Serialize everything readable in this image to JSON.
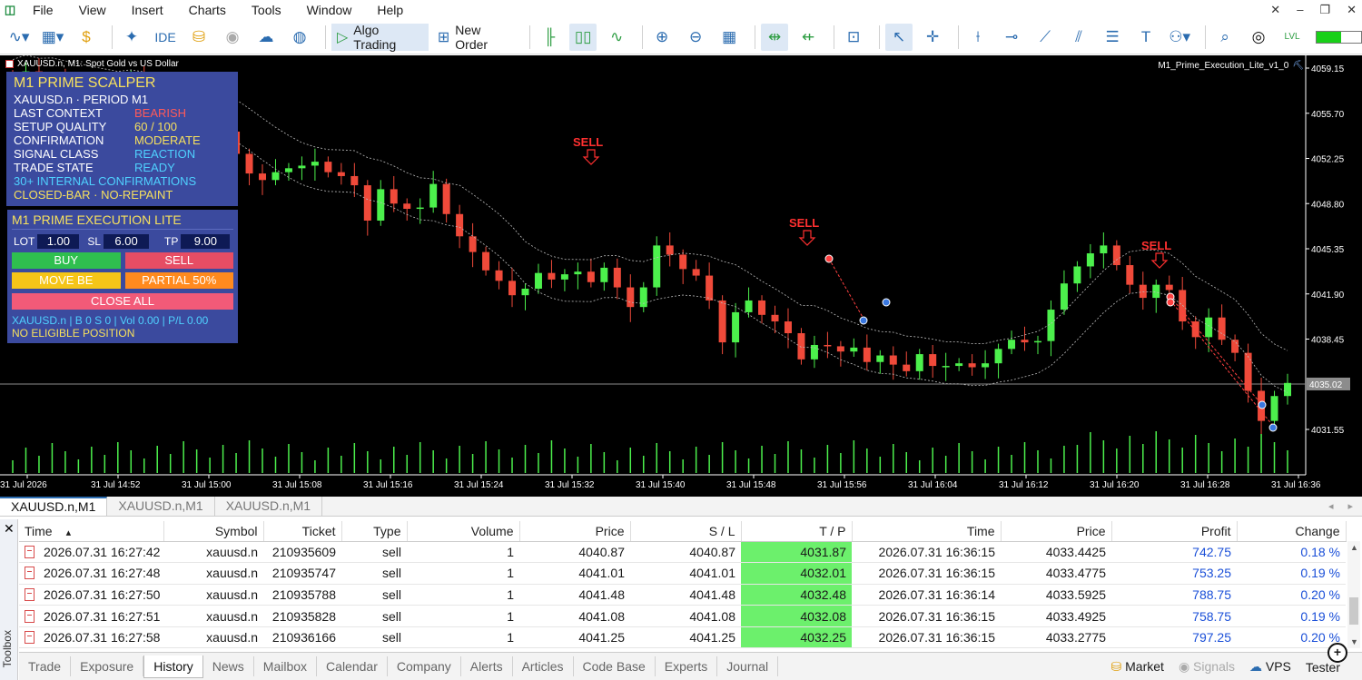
{
  "menu": {
    "items": [
      "File",
      "View",
      "Insert",
      "Charts",
      "Tools",
      "Window",
      "Help"
    ]
  },
  "toolbar": {
    "algo_trading": "Algo Trading",
    "new_order": "New Order",
    "ide_label": "IDE",
    "level_fill_fraction": 0.55
  },
  "chart": {
    "title": "XAUUSD.n, M1:  Spot Gold vs US Dollar",
    "ea_name": "M1_Prime_Execution_Lite_v1_0",
    "current_price": "4035.02",
    "price_labels": [
      "4059.15",
      "4055.70",
      "4052.25",
      "4048.80",
      "4045.35",
      "4041.90",
      "4038.45",
      "4031.55"
    ],
    "time_labels": [
      "31 Jul 2026",
      "31 Jul 14:52",
      "31 Jul 15:00",
      "31 Jul 15:08",
      "31 Jul 15:16",
      "31 Jul 15:24",
      "31 Jul 15:32",
      "31 Jul 15:40",
      "31 Jul 15:48",
      "31 Jul 15:56",
      "31 Jul 16:04",
      "31 Jul 16:12",
      "31 Jul 16:20",
      "31 Jul 16:28",
      "31 Jul 16:36"
    ],
    "signal_label": "SELL",
    "bull_color": "#4cf04c",
    "bear_color": "#f04a3a"
  },
  "scalper": {
    "title": "M1 PRIME SCALPER",
    "symbol_period": "XAUUSD.n · PERIOD M1",
    "rows": [
      {
        "label": "LAST CONTEXT",
        "value": "BEARISH",
        "color": "#ff5a5a"
      },
      {
        "label": "SETUP QUALITY",
        "value": "60 / 100",
        "color": "#f6e05e"
      },
      {
        "label": "CONFIRMATION",
        "value": "MODERATE",
        "color": "#f6e05e"
      },
      {
        "label": "SIGNAL CLASS",
        "value": "REACTION",
        "color": "#4fd1ff"
      },
      {
        "label": "TRADE STATE",
        "value": "READY",
        "color": "#4fd1ff"
      }
    ],
    "confirmations": "30+ INTERNAL CONFIRMATIONS",
    "closed_bar": "CLOSED-BAR · NO-REPAINT"
  },
  "exec": {
    "title": "M1 PRIME EXECUTION LITE",
    "lot_label": "LOT",
    "lot_value": "1.00",
    "sl_label": "SL",
    "sl_value": "6.00",
    "tp_label": "TP",
    "tp_value": "9.00",
    "buy": "BUY",
    "sell": "SELL",
    "move_be": "MOVE BE",
    "partial": "PARTIAL 50%",
    "close_all": "CLOSE ALL",
    "status": "XAUUSD.n | B 0 S 0 | Vol 0.00 | P/L 0.00",
    "position": "NO ELIGIBLE POSITION"
  },
  "chart_tabs": [
    "XAUUSD.n,M1",
    "XAUUSD.n,M1",
    "XAUUSD.n,M1"
  ],
  "toolbox": {
    "label": "Toolbox",
    "columns": [
      "Time",
      "Symbol",
      "Ticket",
      "Type",
      "Volume",
      "Price",
      "S / L",
      "T / P",
      "Time",
      "Price",
      "Profit",
      "Change"
    ],
    "rows": [
      [
        "2026.07.31 16:27:42",
        "xauusd.n",
        "210935609",
        "sell",
        "1",
        "4040.87",
        "4040.87",
        "4031.87",
        "2026.07.31 16:36:15",
        "4033.4425",
        "742.75",
        "0.18 %"
      ],
      [
        "2026.07.31 16:27:48",
        "xauusd.n",
        "210935747",
        "sell",
        "1",
        "4041.01",
        "4041.01",
        "4032.01",
        "2026.07.31 16:36:15",
        "4033.4775",
        "753.25",
        "0.19 %"
      ],
      [
        "2026.07.31 16:27:50",
        "xauusd.n",
        "210935788",
        "sell",
        "1",
        "4041.48",
        "4041.48",
        "4032.48",
        "2026.07.31 16:36:14",
        "4033.5925",
        "788.75",
        "0.20 %"
      ],
      [
        "2026.07.31 16:27:51",
        "xauusd.n",
        "210935828",
        "sell",
        "1",
        "4041.08",
        "4041.08",
        "4032.08",
        "2026.07.31 16:36:15",
        "4033.4925",
        "758.75",
        "0.19 %"
      ],
      [
        "2026.07.31 16:27:58",
        "xauusd.n",
        "210936166",
        "sell",
        "1",
        "4041.25",
        "4041.25",
        "4032.25",
        "2026.07.31 16:36:15",
        "4033.2775",
        "797.25",
        "0.20 %"
      ]
    ]
  },
  "bottom_tabs": [
    "Trade",
    "Exposure",
    "History",
    "News",
    "Mailbox",
    "Calendar",
    "Company",
    "Alerts",
    "Articles",
    "Code Base",
    "Experts",
    "Journal"
  ],
  "bottom_right": {
    "market": "Market",
    "signals": "Signals",
    "vps": "VPS",
    "tester": "Tester"
  }
}
